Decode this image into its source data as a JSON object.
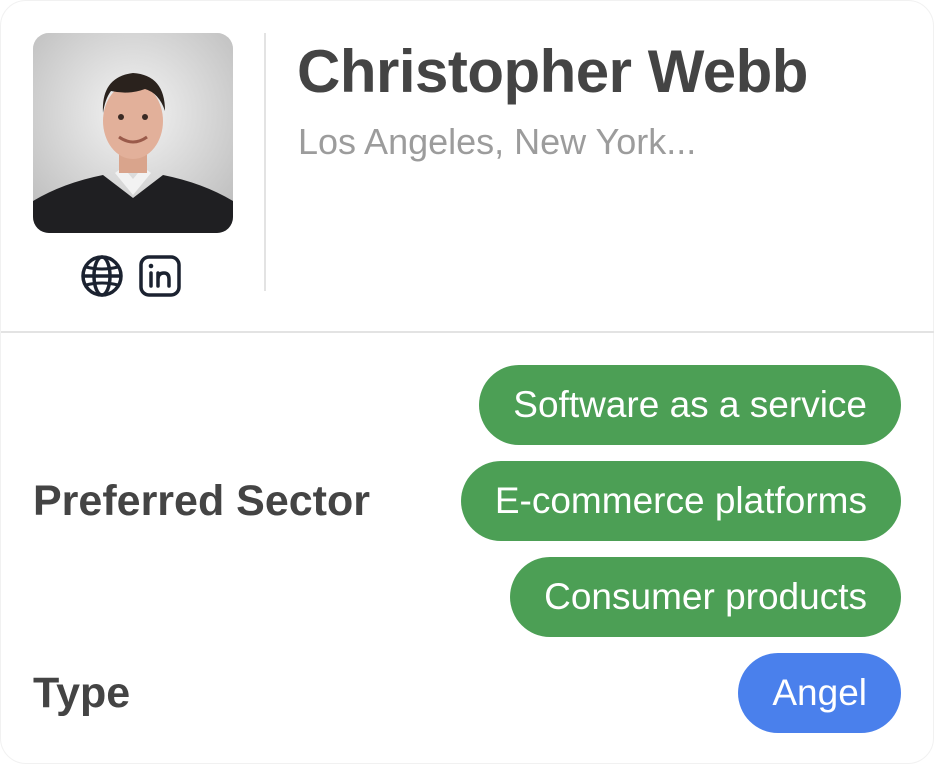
{
  "profile": {
    "name": "Christopher Webb",
    "location": "Los Angeles, New York..."
  },
  "links": {
    "website_icon": "globe-icon",
    "linkedin_icon": "linkedin-icon"
  },
  "details": {
    "sector_label": "Preferred Sector",
    "sectors": [
      "Software as a service",
      "E-commerce platforms",
      "Consumer products"
    ],
    "type_label": "Type",
    "type_value": "Angel"
  },
  "colors": {
    "sector_pill": "#4c9f55",
    "type_pill": "#4a80ec",
    "heading_text": "#444444",
    "muted_text": "#9c9c9c"
  }
}
